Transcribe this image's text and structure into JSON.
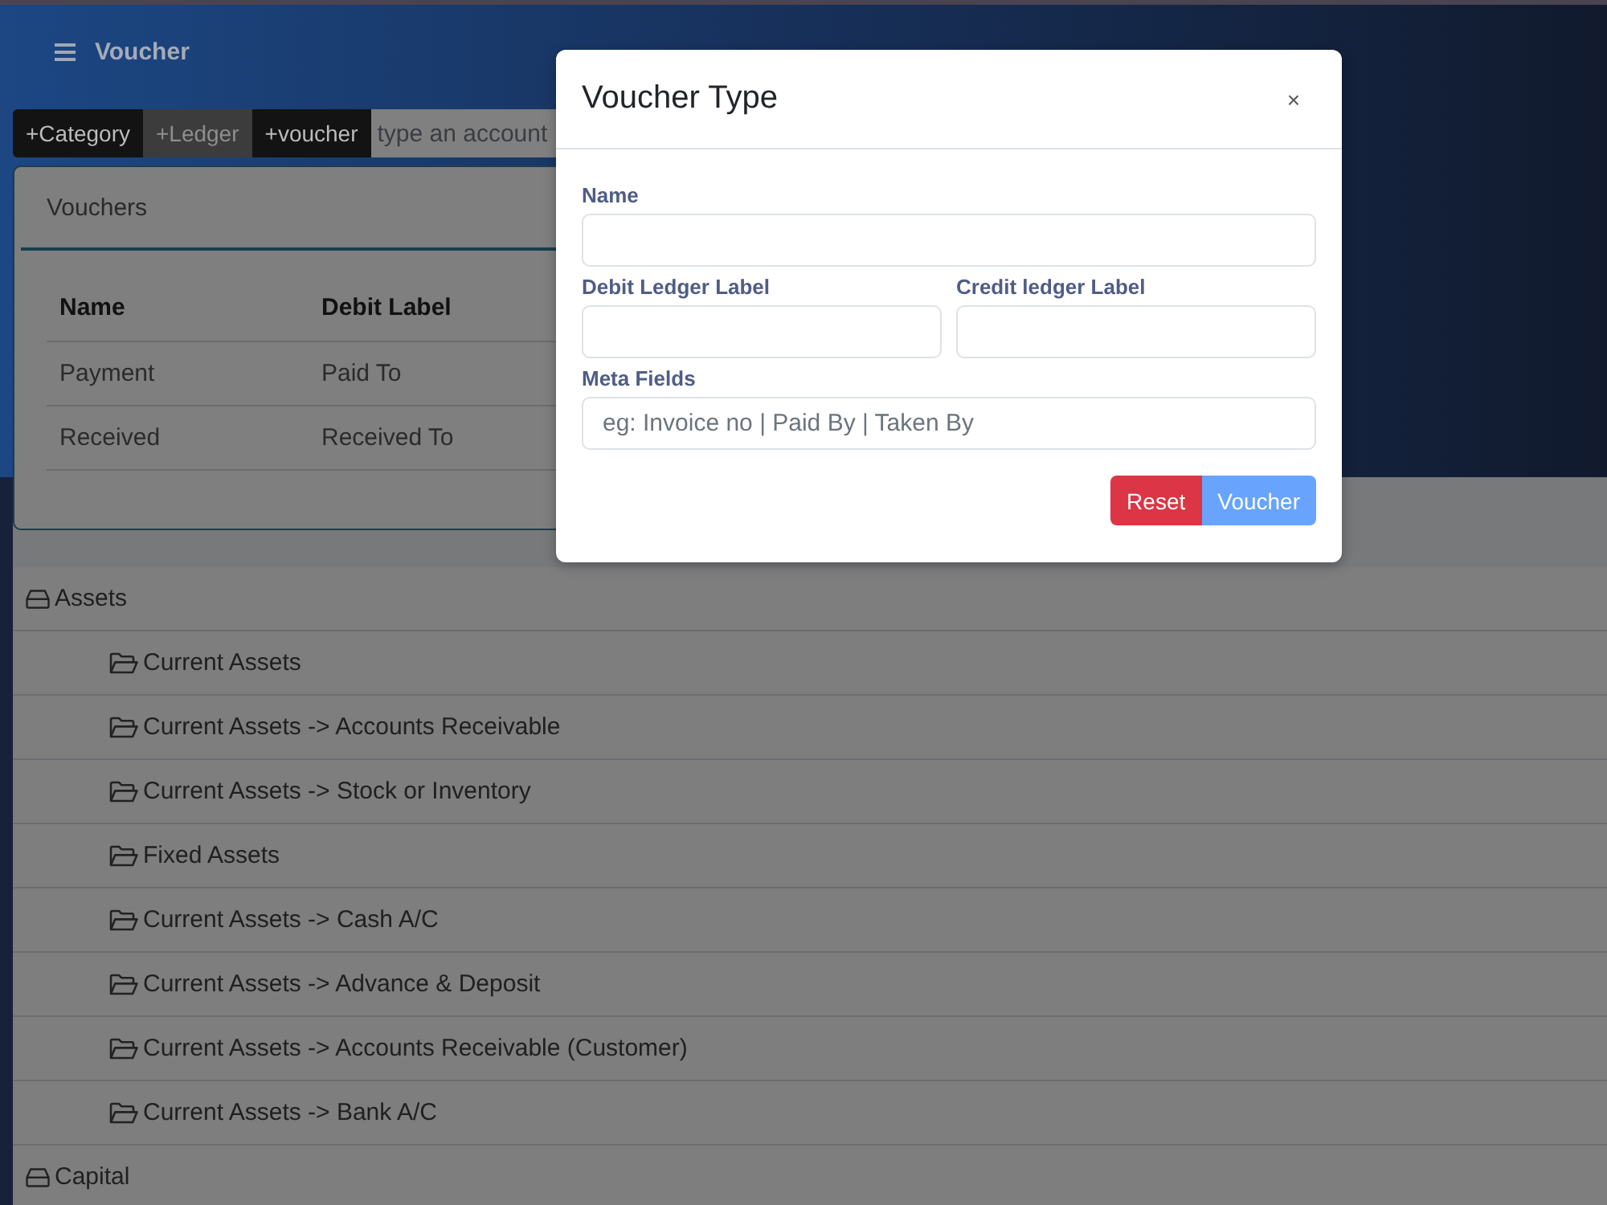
{
  "header": {
    "title": "Voucher"
  },
  "toolbar": {
    "buttons": [
      {
        "label": "+Category",
        "selected": false
      },
      {
        "label": "+Ledger",
        "selected": true
      },
      {
        "label": "+voucher",
        "selected": false
      }
    ],
    "search": {
      "placeholder": "type an account"
    }
  },
  "vouchers_card": {
    "title": "Vouchers",
    "table": {
      "columns": [
        "Name",
        "Debit Label"
      ],
      "rows": [
        [
          "Payment",
          "Paid To"
        ],
        [
          "Received",
          "Received To"
        ]
      ]
    }
  },
  "account_tree": [
    {
      "name": "Assets",
      "children": [
        {
          "name": "Current Assets"
        },
        {
          "name": "Current Assets -> Accounts Receivable"
        },
        {
          "name": "Current Assets -> Stock or Inventory"
        },
        {
          "name": "Fixed Assets"
        },
        {
          "name": "Current Assets -> Cash A/C"
        },
        {
          "name": "Current Assets -> Advance & Deposit"
        },
        {
          "name": "Current Assets -> Accounts Receivable (Customer)"
        },
        {
          "name": "Current Assets -> Bank A/C"
        }
      ]
    },
    {
      "name": "Capital"
    }
  ],
  "modal": {
    "title": "Voucher Type",
    "close": "×",
    "field_rows": [
      [
        {
          "label": "Name"
        }
      ],
      [
        {
          "label": "Debit Ledger Label"
        },
        {
          "label": "Credit ledger Label"
        }
      ],
      [
        {
          "label": "Meta Fields",
          "placeholder": "eg: Invoice no | Paid By | Taken By"
        }
      ]
    ],
    "buttons": [
      {
        "label": "Reset",
        "kind": "danger",
        "disabled": false
      },
      {
        "label": "Voucher",
        "kind": "primary",
        "disabled": true
      }
    ]
  }
}
